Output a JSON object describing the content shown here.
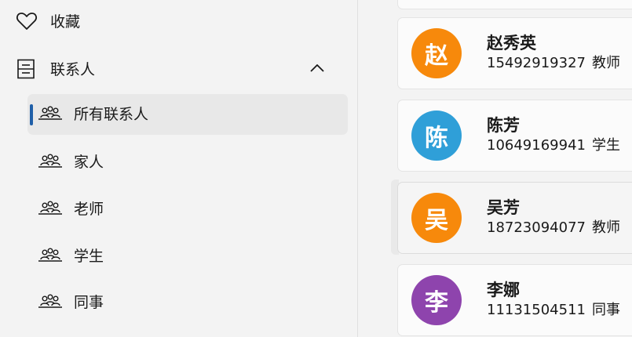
{
  "sidebar": {
    "favorites_label": "收藏",
    "contacts_label": "联系人",
    "sub_items": [
      {
        "label": "所有联系人",
        "selected": true
      },
      {
        "label": "家人",
        "selected": false
      },
      {
        "label": "老师",
        "selected": false
      },
      {
        "label": "学生",
        "selected": false
      },
      {
        "label": "同事",
        "selected": false
      }
    ]
  },
  "contacts": [
    {
      "avatar_char": "赵",
      "name": "赵秀英",
      "phone": "15492919327",
      "group": "教师",
      "color": "#f7890b"
    },
    {
      "avatar_char": "陈",
      "name": "陈芳",
      "phone": "10649169941",
      "group": "学生",
      "color": "#2f9fd8"
    },
    {
      "avatar_char": "吴",
      "name": "吴芳",
      "phone": "18723094077",
      "group": "教师",
      "color": "#f7890b"
    },
    {
      "avatar_char": "李",
      "name": "李娜",
      "phone": "11131504511",
      "group": "同事",
      "color": "#8e44ad"
    }
  ],
  "icons": {
    "favorites": "heart-icon",
    "contacts": "contact-card-icon",
    "collapse": "chevron-up-icon",
    "group": "people-group-icon"
  }
}
